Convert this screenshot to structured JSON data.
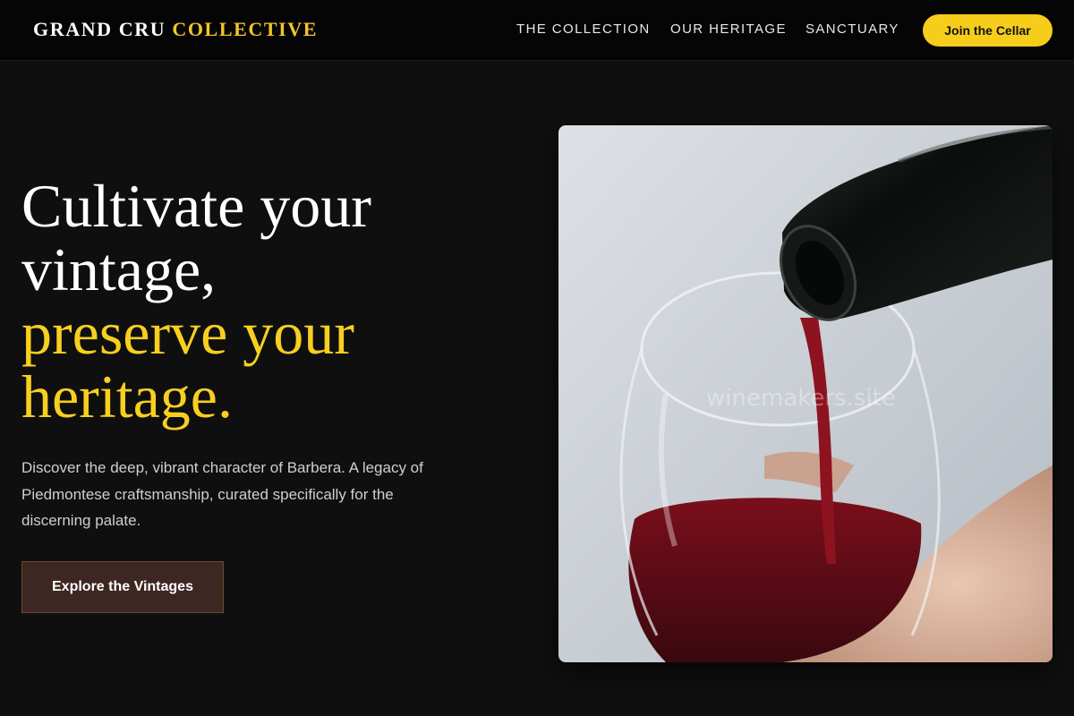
{
  "header": {
    "brand_part1": "GRAND CRU",
    "brand_part2": "COLLECTIVE",
    "nav": [
      "THE COLLECTION",
      "OUR HERITAGE",
      "SANCTUARY"
    ],
    "cta_label": "Join the Cellar"
  },
  "hero": {
    "title_line1": "Cultivate your",
    "title_line2": "vintage,",
    "title_line3": "preserve your",
    "title_line4": "heritage.",
    "description": "Discover the deep, vibrant character of Barbera. A legacy of Piedmontese craftsmanship, curated specifically for the discerning palate.",
    "button_label": "Explore the Vintages",
    "watermark": "winemakers.site"
  },
  "colors": {
    "accent": "#f6cd1a",
    "background": "#0f0f10",
    "button_bg": "#3e2723"
  }
}
